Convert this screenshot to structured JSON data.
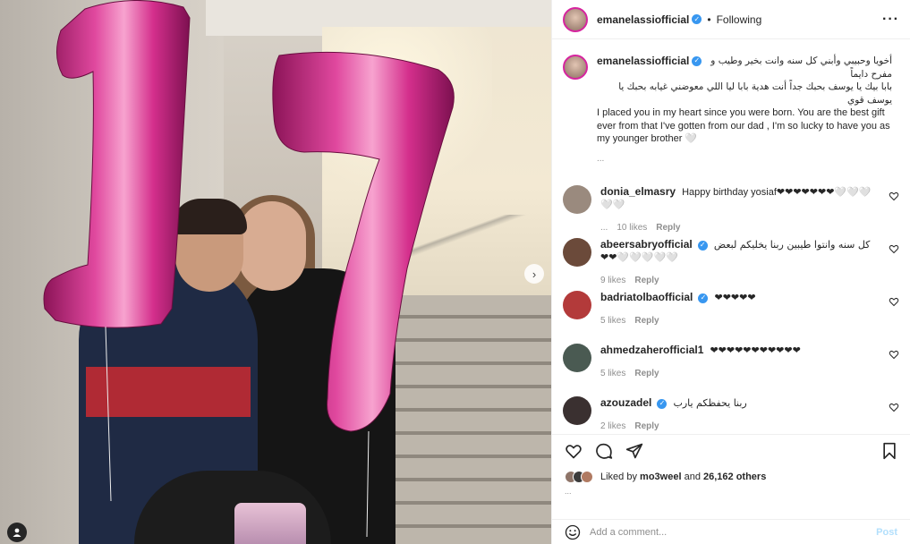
{
  "post": {
    "username": "emanelassiofficial",
    "separator": "•",
    "follow_status": "Following",
    "more_icon": "more-horizontal-icon",
    "balloon_digits": "17"
  },
  "caption": {
    "username": "emanelassiofficial",
    "arabic_line1": "أخويا وحبيبي وأبني كل سنه وانت بخير وطيب و مفرح دايماً",
    "arabic_line2": "بابا بيك يا يوسف بحبك جداً أنت هدية بابا ليا اللي معوضني غيابه بحبك يا يوسف قوي",
    "english": "I placed you in my heart since you were born. You are the best gift ever from that I've gotten from our dad , I'm so lucky to have you as my younger brother 🤍",
    "time": "..."
  },
  "comments": [
    {
      "username": "donia_elmasry",
      "verified": false,
      "text": "Happy birthday yosiaf❤❤❤❤❤❤❤🤍🤍🤍🤍🤍",
      "time": "...",
      "likes": "10 likes",
      "reply": "Reply",
      "avatar_color": "#9a8a7e"
    },
    {
      "username": "abeersabryofficial",
      "verified": true,
      "text": "كل سنه وانتوا طيبين ربنا يخليكم لبعض ❤❤🤍🤍🤍🤍🤍",
      "time": "",
      "likes": "9 likes",
      "reply": "Reply",
      "avatar_color": "#6b4a3a"
    },
    {
      "username": "badriatolbaofficial",
      "verified": true,
      "text": "❤❤❤❤❤",
      "time": "",
      "likes": "5 likes",
      "reply": "Reply",
      "avatar_color": "#b33a3a"
    },
    {
      "username": "ahmedzaherofficial1",
      "verified": false,
      "text": "❤❤❤❤❤❤❤❤❤❤❤",
      "time": "",
      "likes": "5 likes",
      "reply": "Reply",
      "avatar_color": "#4a5a52"
    },
    {
      "username": "azouzadel",
      "verified": true,
      "text": "ربنا يحفظكم يارب",
      "time": "",
      "likes": "2 likes",
      "reply": "Reply",
      "avatar_color": "#3a3030"
    }
  ],
  "likes": {
    "prefix": "Liked by",
    "user": "mo3weel",
    "and": "and",
    "count": "26,162 others"
  },
  "date": "...",
  "add_comment": {
    "placeholder": "Add a comment...",
    "post_label": "Post"
  },
  "colors": {
    "accent": "#3897f0",
    "post_disabled": "#b2dffc",
    "balloon": "#d42f8c"
  }
}
